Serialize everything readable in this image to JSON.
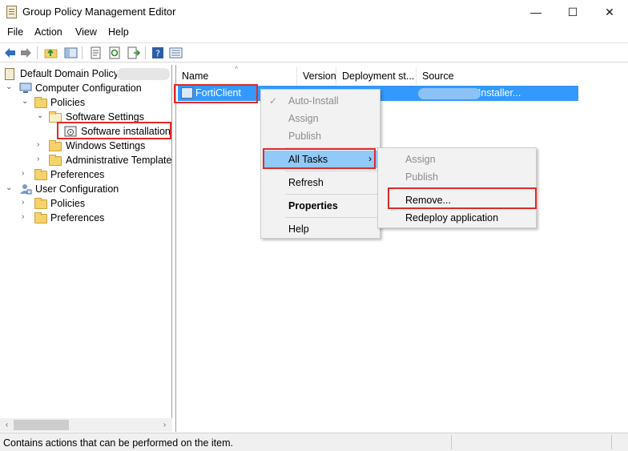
{
  "window": {
    "title": "Group Policy Management Editor",
    "minimize": "—",
    "maximize": "☐",
    "close": "✕"
  },
  "menu": [
    "File",
    "Action",
    "View",
    "Help"
  ],
  "tree": {
    "root": "Default Domain Policy",
    "computer_configuration": "Computer Configuration",
    "policies": "Policies",
    "software_settings": "Software Settings",
    "software_installation": "Software installation",
    "windows_settings": "Windows Settings",
    "administrative_templates": "Administrative Templates",
    "preferences": "Preferences",
    "user_configuration": "User Configuration",
    "user_policies": "Policies",
    "user_preferences": "Preferences"
  },
  "list": {
    "columns": [
      "Name",
      "Version",
      "Deployment st...",
      "Source"
    ],
    "rows": [
      {
        "name": "FortiClient",
        "source": "\\\\                    FortiClient Installer..."
      }
    ]
  },
  "context_menu": {
    "items": [
      "Auto-Install",
      "Assign",
      "Publish",
      "All Tasks",
      "Refresh",
      "Properties",
      "Help"
    ]
  },
  "submenu": {
    "items": [
      "Assign",
      "Publish",
      "Remove...",
      "Redeploy application"
    ]
  },
  "status": {
    "text": "Contains actions that can be performed on the item."
  },
  "colors": {
    "selection": "#3399ff",
    "menu_highlight": "#91c9f7",
    "annotation_red": "#e12a2a"
  }
}
